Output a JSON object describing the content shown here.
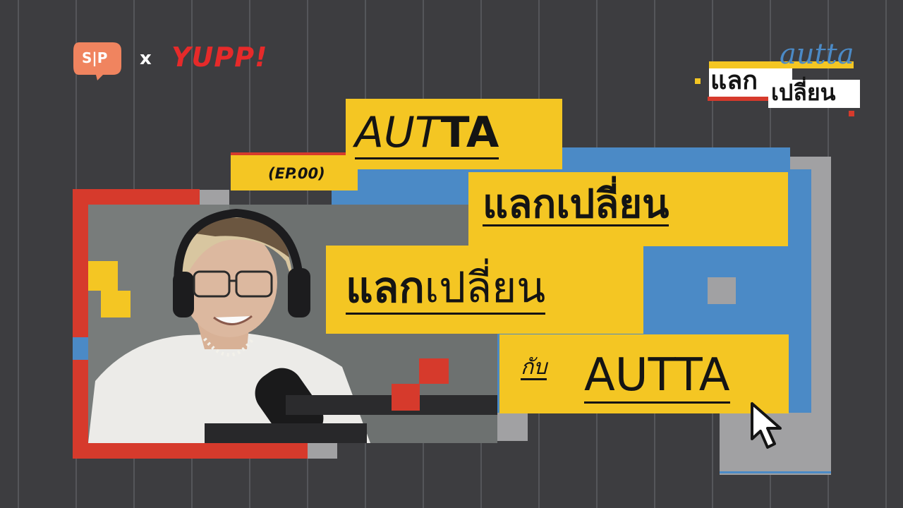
{
  "brand": {
    "sp_logo_text": "S|P",
    "cross": "x",
    "yupp_logo_text": "YUPP!"
  },
  "series_logo": {
    "script_text": "autta",
    "line1": "แลก",
    "line2": "เปลี่ยน"
  },
  "headline": {
    "autta_prefix": "AUT",
    "autta_suffix": "TA",
    "episode": "(EP.00)",
    "line2": "แลกเปลี่ยน",
    "line3_bold": "แลก",
    "line3_light": "เปลี่ยน",
    "with_word": "กับ",
    "autta2_prefix": "AUT",
    "autta2_suffix": "TA"
  },
  "colors": {
    "background": "#3d3d40",
    "grid_line": "#55565a",
    "yellow": "#f4c623",
    "blue": "#4b8ac6",
    "red": "#d63a2c",
    "gray": "#a1a1a3",
    "ink": "#141414"
  },
  "icons": {
    "cursor": "mouse-pointer-icon"
  }
}
